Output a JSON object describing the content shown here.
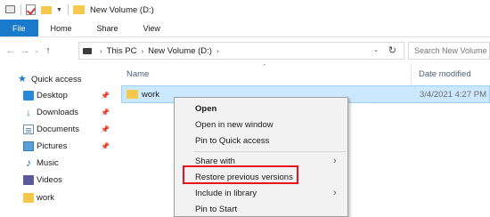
{
  "window": {
    "title": "New Volume (D:)",
    "quick_access_toolbar": [
      "drive-icon",
      "properties-check-icon",
      "new-folder-icon"
    ]
  },
  "ribbon": {
    "tabs": [
      "File",
      "Home",
      "Share",
      "View"
    ],
    "accent_color": "#1979ca"
  },
  "address_bar": {
    "breadcrumbs": [
      "This PC",
      "New Volume (D:)"
    ],
    "search_placeholder": "Search New Volume (D:)"
  },
  "nav_pane": {
    "items": [
      {
        "label": "Quick access",
        "icon": "star-icon",
        "pinned": false
      },
      {
        "label": "Desktop",
        "icon": "desktop-icon",
        "pinned": true
      },
      {
        "label": "Downloads",
        "icon": "download-icon",
        "pinned": true
      },
      {
        "label": "Documents",
        "icon": "documents-icon",
        "pinned": true
      },
      {
        "label": "Pictures",
        "icon": "pictures-icon",
        "pinned": true
      },
      {
        "label": "Music",
        "icon": "music-icon",
        "pinned": false
      },
      {
        "label": "Videos",
        "icon": "videos-icon",
        "pinned": false
      },
      {
        "label": "work",
        "icon": "folder-icon",
        "pinned": false
      }
    ]
  },
  "file_list": {
    "columns": [
      "Name",
      "Date modified"
    ],
    "rows": [
      {
        "name": "work",
        "date_modified": "3/4/2021 4:27 PM",
        "selected": true
      }
    ]
  },
  "context_menu": {
    "items": [
      {
        "label": "Open",
        "bold": true,
        "submenu": false
      },
      {
        "label": "Open in new window",
        "bold": false,
        "submenu": false
      },
      {
        "label": "Pin to Quick access",
        "bold": false,
        "submenu": false
      },
      {
        "label": "Share with",
        "bold": false,
        "submenu": true
      },
      {
        "label": "Restore previous versions",
        "bold": false,
        "submenu": false,
        "highlighted": true
      },
      {
        "label": "Include in library",
        "bold": false,
        "submenu": true
      },
      {
        "label": "Pin to Start",
        "bold": false,
        "submenu": false
      }
    ],
    "highlight_color": "#e8141b"
  }
}
